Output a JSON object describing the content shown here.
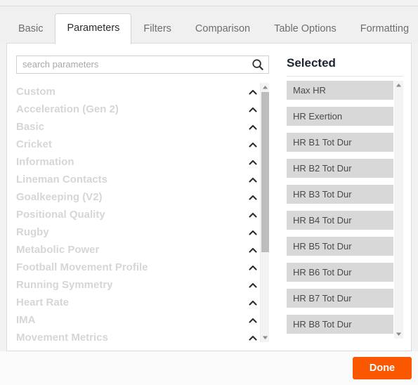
{
  "tabs": [
    {
      "label": "Basic",
      "active": false
    },
    {
      "label": "Parameters",
      "active": true
    },
    {
      "label": "Filters",
      "active": false
    },
    {
      "label": "Comparison",
      "active": false
    },
    {
      "label": "Table Options",
      "active": false
    },
    {
      "label": "Formatting",
      "active": false
    }
  ],
  "search": {
    "placeholder": "search parameters",
    "value": "",
    "icon": "search-icon"
  },
  "categories": [
    {
      "label": "Custom",
      "toggle_icon": "chevron-up-icon"
    },
    {
      "label": "Acceleration (Gen 2)",
      "toggle_icon": "chevron-up-icon"
    },
    {
      "label": "Basic",
      "toggle_icon": "chevron-up-icon"
    },
    {
      "label": "Cricket",
      "toggle_icon": "chevron-up-icon"
    },
    {
      "label": "Information",
      "toggle_icon": "chevron-up-icon"
    },
    {
      "label": "Lineman Contacts",
      "toggle_icon": "chevron-up-icon"
    },
    {
      "label": "Goalkeeping (V2)",
      "toggle_icon": "chevron-up-icon"
    },
    {
      "label": "Positional Quality",
      "toggle_icon": "chevron-up-icon"
    },
    {
      "label": "Rugby",
      "toggle_icon": "chevron-up-icon"
    },
    {
      "label": "Metabolic Power",
      "toggle_icon": "chevron-up-icon"
    },
    {
      "label": "Football Movement Profile",
      "toggle_icon": "chevron-up-icon"
    },
    {
      "label": "Running Symmetry",
      "toggle_icon": "chevron-up-icon"
    },
    {
      "label": "Heart Rate",
      "toggle_icon": "chevron-up-icon"
    },
    {
      "label": "IMA",
      "toggle_icon": "chevron-up-icon"
    },
    {
      "label": "Movement Metrics",
      "toggle_icon": "chevron-up-icon"
    }
  ],
  "selected": {
    "title": "Selected",
    "items": [
      {
        "label": "Max HR"
      },
      {
        "label": "HR Exertion"
      },
      {
        "label": "HR B1 Tot Dur"
      },
      {
        "label": "HR B2 Tot Dur"
      },
      {
        "label": "HR B3 Tot Dur"
      },
      {
        "label": "HR B4 Tot Dur"
      },
      {
        "label": "HR B5 Tot Dur"
      },
      {
        "label": "HR B6 Tot Dur"
      },
      {
        "label": "HR B7 Tot Dur"
      },
      {
        "label": "HR B8 Tot Dur"
      }
    ]
  },
  "footer": {
    "done_label": "Done",
    "done_color": "#fa5800"
  },
  "colors": {
    "accent": "#fa5800",
    "tabstrip_bg": "#f0f0f0",
    "panel_bg": "#ffffff",
    "category_text": "#d6d6d6",
    "selected_item_bg": "#d8d8d8"
  }
}
